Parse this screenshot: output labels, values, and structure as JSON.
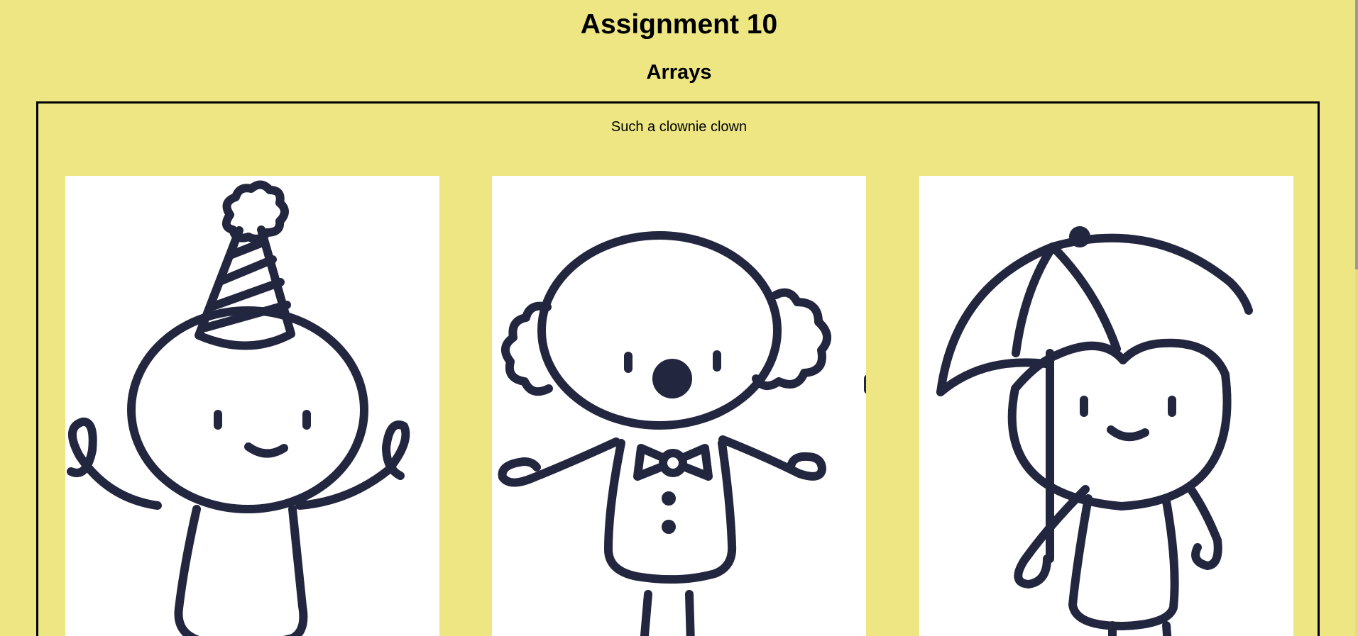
{
  "page": {
    "title": "Assignment 10",
    "subtitle": "Arrays",
    "caption": "Such a clownie clown"
  },
  "gallery": {
    "images": [
      {
        "icon": "clown-party-hat-drawing"
      },
      {
        "icon": "clown-bow-tie-drawing"
      },
      {
        "icon": "clown-umbrella-drawing"
      }
    ]
  },
  "colors": {
    "background": "#ede683",
    "frame_border": "#000000",
    "ink": "#23263f",
    "card": "#ffffff"
  }
}
